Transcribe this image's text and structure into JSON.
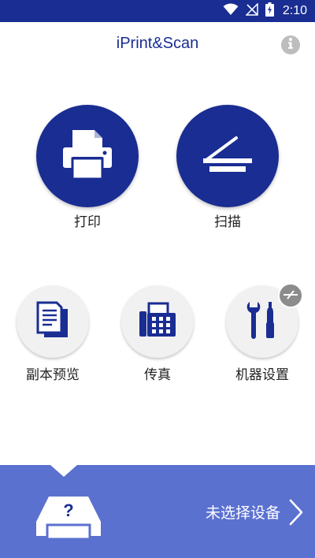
{
  "status_bar": {
    "time": "2:10",
    "icons": [
      "wifi-icon",
      "no-signal-icon",
      "battery-charging-icon"
    ]
  },
  "header": {
    "title": "iPrint&Scan",
    "info_icon": "info-icon"
  },
  "main_actions": [
    {
      "label": "打印",
      "icon": "printer-icon"
    },
    {
      "label": "扫描",
      "icon": "scanner-icon"
    }
  ],
  "secondary_actions": [
    {
      "label": "副本预览",
      "icon": "copy-preview-icon"
    },
    {
      "label": "传真",
      "icon": "fax-icon"
    },
    {
      "label": "机器设置",
      "icon": "tools-icon",
      "badge_icon": "disconnected-icon"
    }
  ],
  "device_panel": {
    "status_text": "未选择设备",
    "icon": "unknown-printer-icon",
    "chevron_icon": "chevron-right-icon"
  },
  "colors": {
    "brand": "#1a2d92",
    "panel": "#5b71d0",
    "button_bg": "#f1f1f1"
  }
}
